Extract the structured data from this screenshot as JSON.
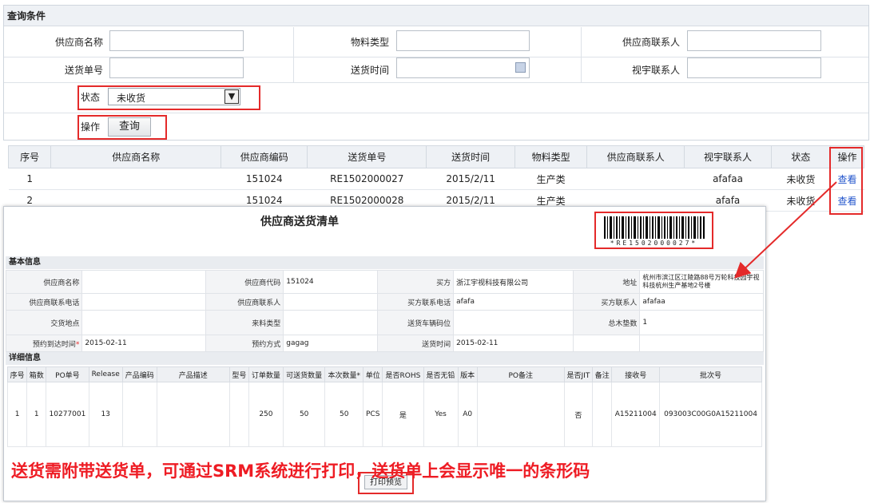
{
  "query": {
    "title": "查询条件",
    "supplier_name_label": "供应商名称",
    "material_type_label": "物料类型",
    "supplier_contact_label": "供应商联系人",
    "delivery_no_label": "送货单号",
    "delivery_time_label": "送货时间",
    "shiyu_contact_label": "视宇联系人",
    "status_label": "状态",
    "status_value": "未收货",
    "action_label": "操作",
    "search_button": "查询"
  },
  "list": {
    "headers": [
      "序号",
      "供应商名称",
      "供应商编码",
      "送货单号",
      "送货时间",
      "物料类型",
      "供应商联系人",
      "视宇联系人",
      "状态",
      "操作"
    ],
    "rows": [
      {
        "no": "1",
        "code": "151024",
        "delivery_no": "RE1502000027",
        "time": "2015/2/11",
        "type": "生产类",
        "contact": "afafaa",
        "status": "未收货",
        "action": "查看"
      },
      {
        "no": "2",
        "code": "151024",
        "delivery_no": "RE1502000028",
        "time": "2015/2/11",
        "type": "生产类",
        "contact": "afafa",
        "status": "未收货",
        "action": "查看"
      }
    ]
  },
  "print": {
    "title": "供应商送货清单",
    "barcode_text": "*RE1502000027*",
    "basic_section": "基本信息",
    "basic": {
      "supplier_name_label": "供应商名称",
      "supplier_code_label": "供应商代码",
      "supplier_code": "151024",
      "buyer_label": "买方",
      "buyer": "浙江宇视科技有限公司",
      "address_label": "地址",
      "address": "杭州市滨江区江陵路88号万轮科技园宇视科技杭州生产基地2号楼",
      "supplier_phone_label": "供应商联系电话",
      "supplier_contact_label": "供应商联系人",
      "buyer_phone_label": "买方联系电话",
      "buyer_phone": "afafa",
      "buyer_contact_label": "买方联系人",
      "buyer_contact": "afafaa",
      "delivery_place_label": "交货地点",
      "material_type_label": "来料类型",
      "vehicle_label": "送货车辆码位",
      "total_pallets_label": "总木垫数",
      "total_pallets": "1",
      "arrival_label": "预约到达时间",
      "arrival": "2015-02-11",
      "method_label": "预约方式",
      "method": "gagag",
      "delivery_time_label": "送货时间",
      "delivery_time": "2015-02-11"
    },
    "detail_section": "详细信息",
    "detail_headers": [
      "序号",
      "箱数",
      "PO单号",
      "Release",
      "产品编码",
      "产品描述",
      "型号",
      "订单数量",
      "可送货数量",
      "本次数量*",
      "单位",
      "是否ROHS",
      "是否无铅",
      "版本",
      "PO备注",
      "是否JIT",
      "备注",
      "接收号",
      "批次号"
    ],
    "detail_row": [
      "1",
      "1",
      "10277001",
      "13",
      "",
      "",
      "",
      "250",
      "50",
      "50",
      "PCS",
      "是",
      "Yes",
      "A0",
      "",
      "否",
      "",
      "A15211004",
      "093003C00G0A15211004"
    ],
    "preview_button": "打印预览"
  },
  "annotation": "送货需附带送货单，可通过SRM系统进行打印，送货单上会显示唯一的条形码",
  "colors": {
    "annotation": "#ee1c24",
    "link": "#2255cc",
    "highlight": "#e42a2a"
  }
}
